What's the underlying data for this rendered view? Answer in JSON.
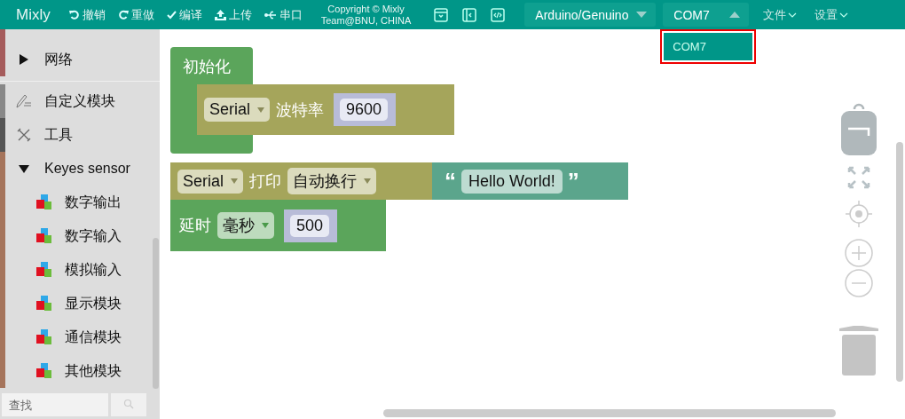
{
  "header": {
    "logo": "Mixly",
    "actions": [
      {
        "kind": "undo",
        "label": "撤销"
      },
      {
        "kind": "redo",
        "label": "重做"
      },
      {
        "kind": "compile",
        "label": "编译"
      },
      {
        "kind": "upload",
        "label": "上传"
      },
      {
        "kind": "serial",
        "label": "串口"
      }
    ],
    "copyright": [
      "Copyright © Mixly",
      "Team@BNU, CHINA"
    ],
    "board": "Arduino/Genuino",
    "port": {
      "value": "COM7",
      "expanded": true
    },
    "port_options": [
      {
        "label": "COM7",
        "selected": true
      }
    ],
    "menus": [
      "文件",
      "设置"
    ]
  },
  "sidebar": {
    "categories": [
      {
        "kind": "cut",
        "color": "#a55b5b"
      },
      {
        "kind": "arrow",
        "label": "网络",
        "expanded": false,
        "color": "#a55b5b"
      },
      {
        "kind": "divider"
      },
      {
        "kind": "pencil",
        "label": "自定义模块",
        "color": "#888888"
      },
      {
        "kind": "tools",
        "label": "工具",
        "color": "#555555"
      },
      {
        "kind": "arrow",
        "label": "Keyes sensor",
        "expanded": true,
        "color": "#a5745b",
        "children": [
          {
            "label": "数字输出"
          },
          {
            "label": "数字输入"
          },
          {
            "label": "模拟输入"
          },
          {
            "label": "显示模块"
          },
          {
            "label": "通信模块"
          },
          {
            "label": "其他模块"
          }
        ]
      }
    ],
    "search": {
      "placeholder": "查找"
    }
  },
  "blocks": [
    {
      "kind": "setup",
      "label": "初始化",
      "child": {
        "serial": "Serial",
        "label": "波特率",
        "value": "9600"
      }
    },
    {
      "kind": "print",
      "serial": "Serial",
      "label": "打印",
      "mode": "自动换行",
      "open_quote": "“",
      "text": "Hello World!",
      "close_quote": "”"
    },
    {
      "kind": "delay",
      "label": "延时",
      "unit": "毫秒",
      "value": "500"
    }
  ]
}
